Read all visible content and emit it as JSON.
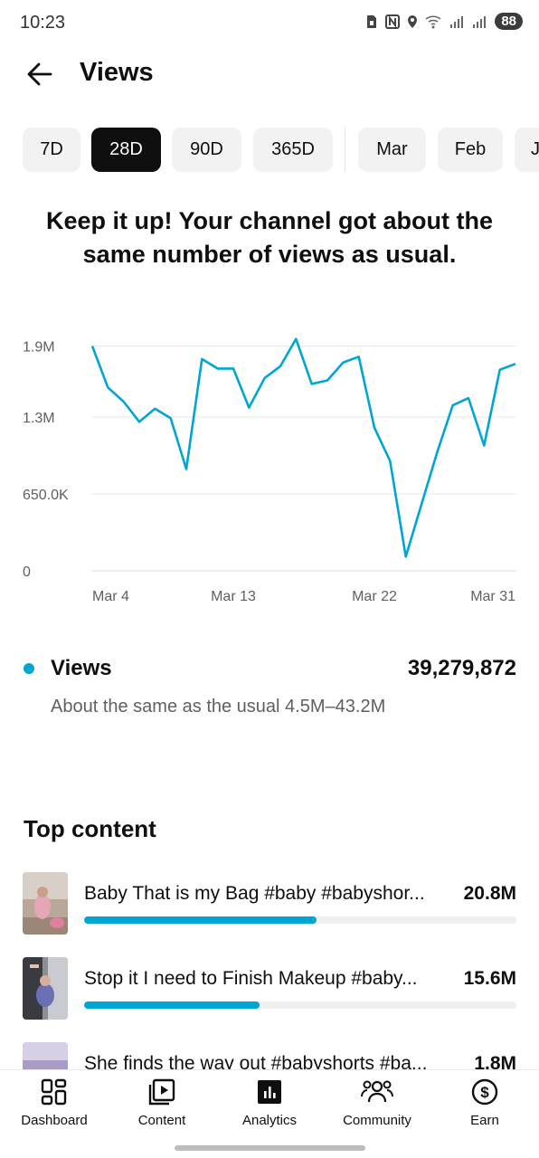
{
  "status_bar": {
    "time": "10:23",
    "battery": "88"
  },
  "header": {
    "title": "Views"
  },
  "period_chips": [
    {
      "label": "7D",
      "active": false
    },
    {
      "label": "28D",
      "active": true
    },
    {
      "label": "90D",
      "active": false
    },
    {
      "label": "365D",
      "active": false
    },
    {
      "label": "Mar",
      "active": false
    },
    {
      "label": "Feb",
      "active": false
    },
    {
      "label": "J",
      "active": false
    }
  ],
  "headline": "Keep it up! Your channel got about the same number of views as usual.",
  "chart_data": {
    "type": "line",
    "title": "",
    "xlabel": "",
    "ylabel": "",
    "y_ticks": [
      "1.9M",
      "1.3M",
      "650.0K",
      "0"
    ],
    "x_ticks": [
      "Mar 4",
      "Mar 13",
      "Mar 22",
      "Mar 31"
    ],
    "ylim": [
      0,
      1950000
    ],
    "grid": true,
    "color": "#00a6d3",
    "series": [
      {
        "x": [
          "Mar 4",
          "Mar 5",
          "Mar 6",
          "Mar 7",
          "Mar 8",
          "Mar 9",
          "Mar 10",
          "Mar 11",
          "Mar 12",
          "Mar 13",
          "Mar 14",
          "Mar 15",
          "Mar 16",
          "Mar 17",
          "Mar 18",
          "Mar 19",
          "Mar 20",
          "Mar 21",
          "Mar 22",
          "Mar 23",
          "Mar 24",
          "Mar 25",
          "Mar 26",
          "Mar 27",
          "Mar 28",
          "Mar 29",
          "Mar 30",
          "Mar 31"
        ],
        "values": [
          1900000,
          1550000,
          1430000,
          1260000,
          1370000,
          1290000,
          860000,
          1790000,
          1710000,
          1710000,
          1380000,
          1630000,
          1730000,
          1960000,
          1580000,
          1610000,
          1760000,
          1810000,
          1210000,
          930000,
          120000,
          560000,
          1000000,
          1400000,
          1460000,
          1060000,
          1700000,
          1750000
        ]
      }
    ]
  },
  "metric": {
    "label": "Views",
    "value": "39,279,872",
    "description": "About the same as the usual 4.5M–43.2M",
    "color": "#00a6d3"
  },
  "top_content": {
    "title": "Top content",
    "items": [
      {
        "title": "Baby That is my Bag #baby #babyshor...",
        "value": "20.8M",
        "fraction": 0.537
      },
      {
        "title": "Stop it I need to Finish Makeup #baby...",
        "value": "15.6M",
        "fraction": 0.406
      },
      {
        "title": "She finds the way out #babyshorts #ba...",
        "value": "1.8M",
        "fraction": 0.05
      }
    ]
  },
  "bottom_nav": [
    {
      "label": "Dashboard",
      "icon": "dashboard-icon"
    },
    {
      "label": "Content",
      "icon": "content-icon"
    },
    {
      "label": "Analytics",
      "icon": "analytics-icon",
      "active": true
    },
    {
      "label": "Community",
      "icon": "community-icon"
    },
    {
      "label": "Earn",
      "icon": "earn-icon"
    }
  ]
}
